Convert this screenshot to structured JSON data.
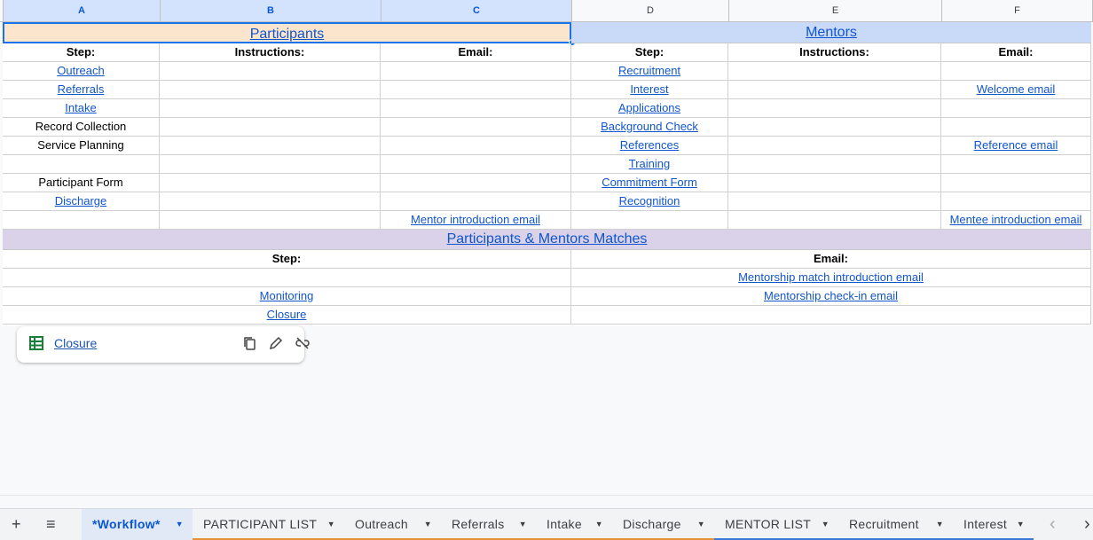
{
  "columns": [
    "A",
    "B",
    "C",
    "D",
    "E",
    "F"
  ],
  "participants": {
    "title": "Participants",
    "headers": [
      "Step:",
      "Instructions:",
      "Email:"
    ],
    "rows": [
      {
        "step": "Outreach",
        "step_link": true,
        "instructions": "",
        "email": ""
      },
      {
        "step": "Referrals",
        "step_link": true,
        "instructions": "",
        "email": ""
      },
      {
        "step": "Intake",
        "step_link": true,
        "instructions": "",
        "email": ""
      },
      {
        "step": "Record Collection",
        "step_link": false,
        "instructions": "",
        "email": ""
      },
      {
        "step": "Service Planning",
        "step_link": false,
        "instructions": "",
        "email": ""
      },
      {
        "step": "",
        "step_link": false,
        "instructions": "",
        "email": ""
      },
      {
        "step": "Participant Form",
        "step_link": false,
        "instructions": "",
        "email": ""
      },
      {
        "step": "Discharge",
        "step_link": true,
        "instructions": "",
        "email": ""
      },
      {
        "step": "",
        "step_link": false,
        "instructions": "",
        "email": "Mentor introduction email"
      }
    ]
  },
  "mentors": {
    "title": "Mentors",
    "headers": [
      "Step:",
      "Instructions:",
      "Email:"
    ],
    "rows": [
      {
        "step": "Recruitment",
        "instructions": "",
        "email": ""
      },
      {
        "step": "Interest",
        "instructions": "",
        "email": "Welcome email"
      },
      {
        "step": "Applications",
        "instructions": "",
        "email": ""
      },
      {
        "step": "Background Check",
        "instructions": "",
        "email": ""
      },
      {
        "step": "References",
        "instructions": "",
        "email": "Reference email"
      },
      {
        "step": "Training",
        "instructions": "",
        "email": ""
      },
      {
        "step": "Commitment Form",
        "instructions": "",
        "email": ""
      },
      {
        "step": "Recognition",
        "instructions": "",
        "email": ""
      },
      {
        "step": "",
        "instructions": "",
        "email": "Mentee introduction email"
      }
    ]
  },
  "matches": {
    "title": "Participants & Mentors Matches",
    "headers": [
      "Step:",
      "Email:"
    ],
    "rows": [
      {
        "step": "",
        "email": "Mentorship match introduction email"
      },
      {
        "step": "Monitoring",
        "email": "Mentorship check-in email"
      },
      {
        "step": "Closure",
        "email": ""
      }
    ]
  },
  "link_chip": {
    "title": "Closure",
    "icons": [
      "sheets-icon",
      "copy-icon",
      "edit-icon",
      "unlink-icon"
    ]
  },
  "tabs": [
    {
      "label": "*Workflow*",
      "active": true,
      "color": ""
    },
    {
      "label": "PARTICIPANT LIST",
      "active": false,
      "color": "#e69138"
    },
    {
      "label": "Outreach",
      "active": false,
      "color": "#e69138"
    },
    {
      "label": "Referrals",
      "active": false,
      "color": "#e69138"
    },
    {
      "label": "Intake",
      "active": false,
      "color": "#e69138"
    },
    {
      "label": "Discharge",
      "active": false,
      "color": "#e69138"
    },
    {
      "label": "MENTOR LIST",
      "active": false,
      "color": "#3c78d8"
    },
    {
      "label": "Recruitment",
      "active": false,
      "color": "#3c78d8"
    },
    {
      "label": "Interest",
      "active": false,
      "color": "#3c78d8"
    }
  ],
  "tabbar_icons": {
    "add": "+",
    "list": "≡",
    "prev": "‹",
    "next": "›"
  },
  "colors": {
    "participants_band": "#fce5cd",
    "mentors_band": "#c9daf8",
    "matches_band": "#d9d2e9",
    "link": "#1155cc"
  }
}
